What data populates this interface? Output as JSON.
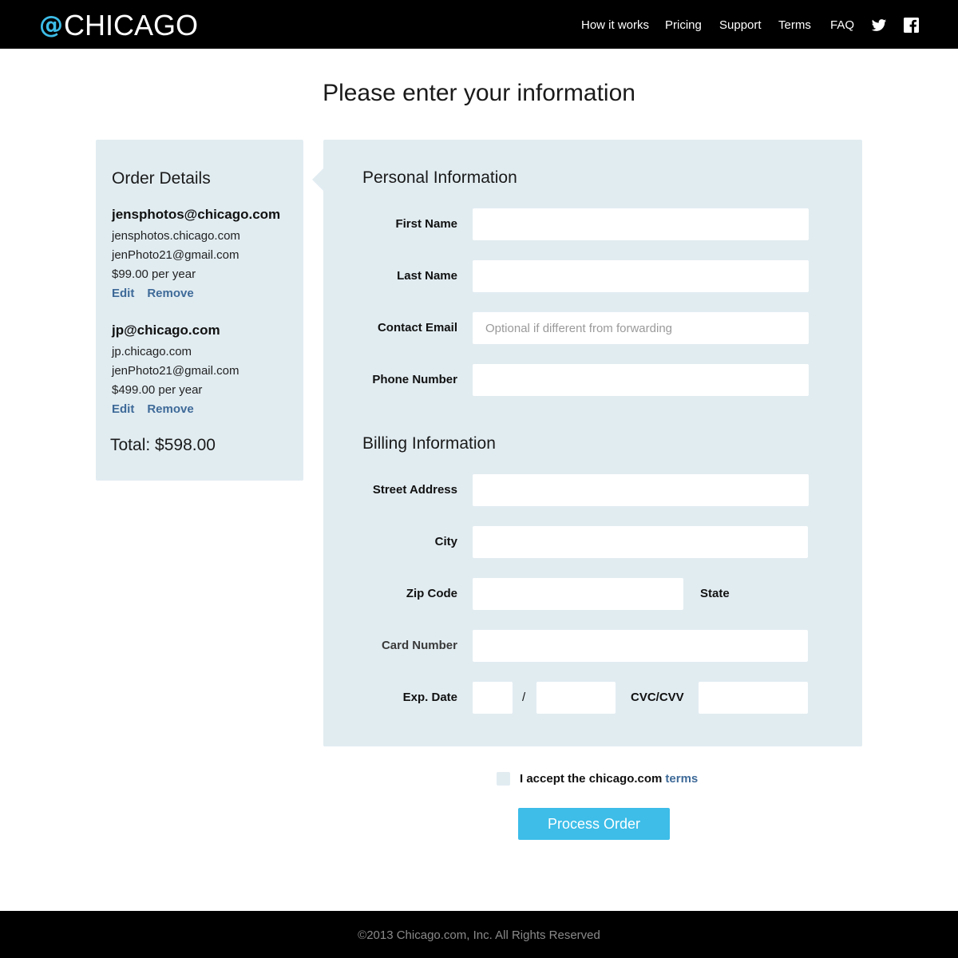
{
  "brand": {
    "at": "@",
    "name": "CHICAGO",
    "accent_color": "#3dbde8"
  },
  "nav": {
    "links": [
      "How it works",
      "Pricing",
      "Support",
      "Terms",
      "FAQ"
    ],
    "social": [
      "twitter-icon",
      "facebook-icon"
    ]
  },
  "page_title": "Please enter your information",
  "order": {
    "heading": "Order Details",
    "items": [
      {
        "title": "jensphotos@chicago.com",
        "domain": "jensphotos.chicago.com",
        "forward": "jenPhoto21@gmail.com",
        "price": "$99.00 per year",
        "edit": "Edit",
        "remove": "Remove"
      },
      {
        "title": "jp@chicago.com",
        "domain": "jp.chicago.com",
        "forward": "jenPhoto21@gmail.com",
        "price": "$499.00 per year",
        "edit": "Edit",
        "remove": "Remove"
      }
    ],
    "total": "Total: $598.00"
  },
  "personal": {
    "heading": "Personal Information",
    "first_name": "First Name",
    "last_name": "Last Name",
    "contact_email": "Contact Email",
    "contact_email_placeholder": "Optional if different from forwarding",
    "phone": "Phone Number"
  },
  "billing": {
    "heading": "Billing Information",
    "street": "Street Address",
    "city": "City",
    "zip": "Zip Code",
    "state": "State",
    "card": "Card Number",
    "exp": "Exp. Date",
    "exp_sep": "/",
    "cvc": "CVC/CVV"
  },
  "terms": {
    "text": "I accept the chicago.com",
    "link": "terms"
  },
  "process_button": "Process Order",
  "footer": "©2013 Chicago.com, Inc. All Rights Reserved"
}
